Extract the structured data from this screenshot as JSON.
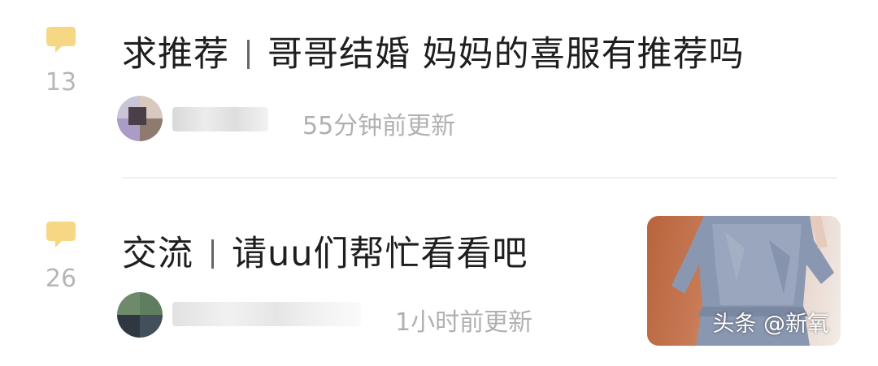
{
  "colors": {
    "reply_icon": "#f6d784",
    "reply_count": "#b6b6b6",
    "title_text": "#1e1e1e",
    "meta_text": "#b0b0b0",
    "divider": "#efefef"
  },
  "posts": [
    {
      "icon": "speech-bubble-icon",
      "reply_count": "13",
      "title_tag": "求推荐",
      "title_text": "哥哥结婚 妈妈的喜服有推荐吗",
      "update_time": "55分钟前更新"
    },
    {
      "icon": "speech-bubble-icon",
      "reply_count": "26",
      "title_tag": "交流",
      "title_text": "请uu们帮忙看看吧",
      "update_time": "1小时前更新"
    }
  ],
  "watermark": "头条 @新氧"
}
